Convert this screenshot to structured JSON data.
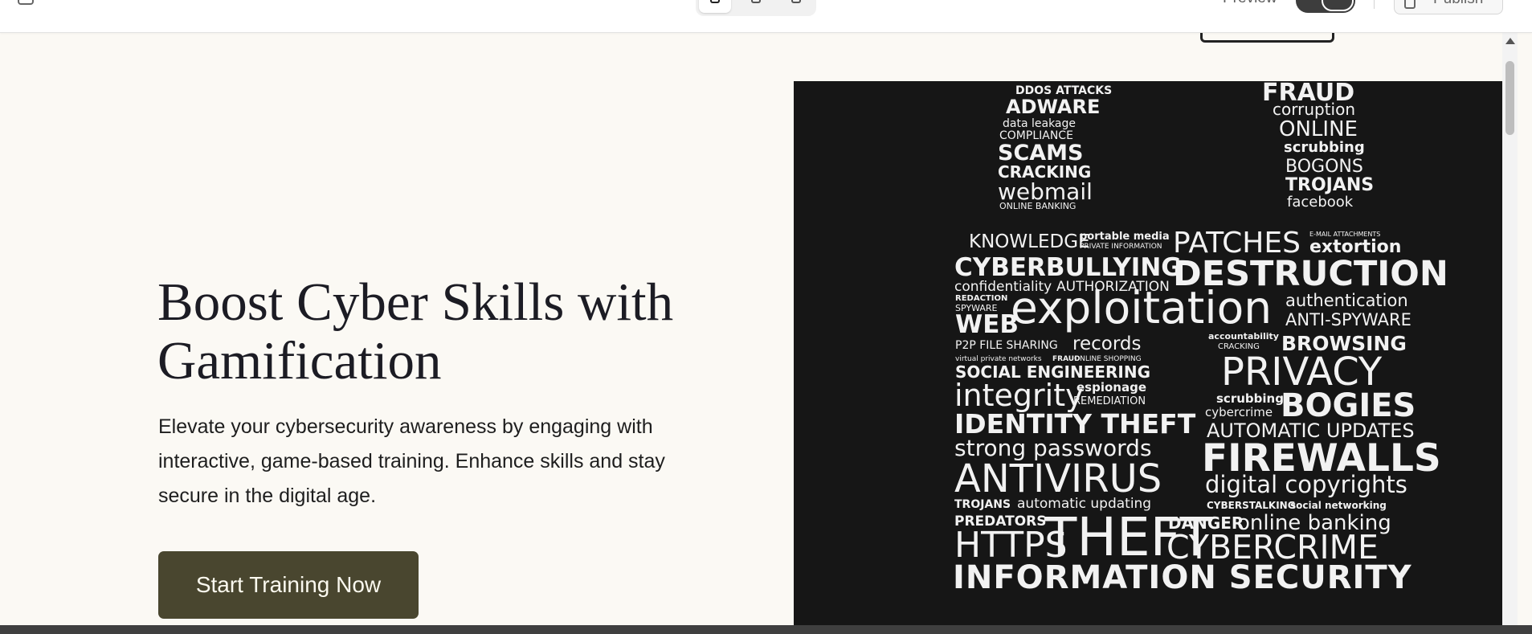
{
  "topbar": {
    "preview_label": "Preview",
    "publish_label": "Publish"
  },
  "hero": {
    "title": "Boost Cyber Skills with Gamification",
    "subtitle": "Elevate your cybersecurity awareness by engaging with interactive, game-based training. Enhance skills and stay secure in the digital age.",
    "cta_label": "Start Training Now"
  },
  "word_cloud": {
    "words": [
      "DDOS ATTACKS",
      "ADWARE",
      "data leakage",
      "COMPLIANCE",
      "SCAMS",
      "CRACKING",
      "webmail",
      "ONLINE BANKING",
      "FRAUD",
      "corruption",
      "ONLINE",
      "scrubbing",
      "BOGONS",
      "TROJANS",
      "facebook",
      "KNOWLEDGE",
      "portable media",
      "PRIVATE INFORMATION",
      "PATCHES",
      "E-MAIL ATTACHMENTS",
      "extortion",
      "CYBERBULLYING",
      "DESTRUCTION",
      "confidentiality",
      "AUTHORIZATION",
      "REDACTION",
      "SPYWARE",
      "WEB",
      "exploitation",
      "authentication",
      "ANTI-SPYWARE",
      "P2P FILE SHARING",
      "records",
      "accountability",
      "CRACKING",
      "BROWSING",
      "virtual private networks",
      "FRAUD",
      "ONLINE SHOPPING",
      "SOCIAL ENGINEERING",
      "PRIVACY",
      "integrity",
      "espionage",
      "REMEDIATION",
      "scrubbing",
      "cybercrime",
      "BOGIES",
      "IDENTITY THEFT",
      "AUTOMATIC UPDATES",
      "strong passwords",
      "FIREWALLS",
      "ANTIVIRUS",
      "digital copyrights",
      "TROJANS",
      "automatic updating",
      "CYBERSTALKING",
      "social networking",
      "PREDATORS",
      "DANGER",
      "online banking",
      "HTTPS",
      "THEFT",
      "CYBERCRIME",
      "INFORMATION SECURITY"
    ]
  }
}
